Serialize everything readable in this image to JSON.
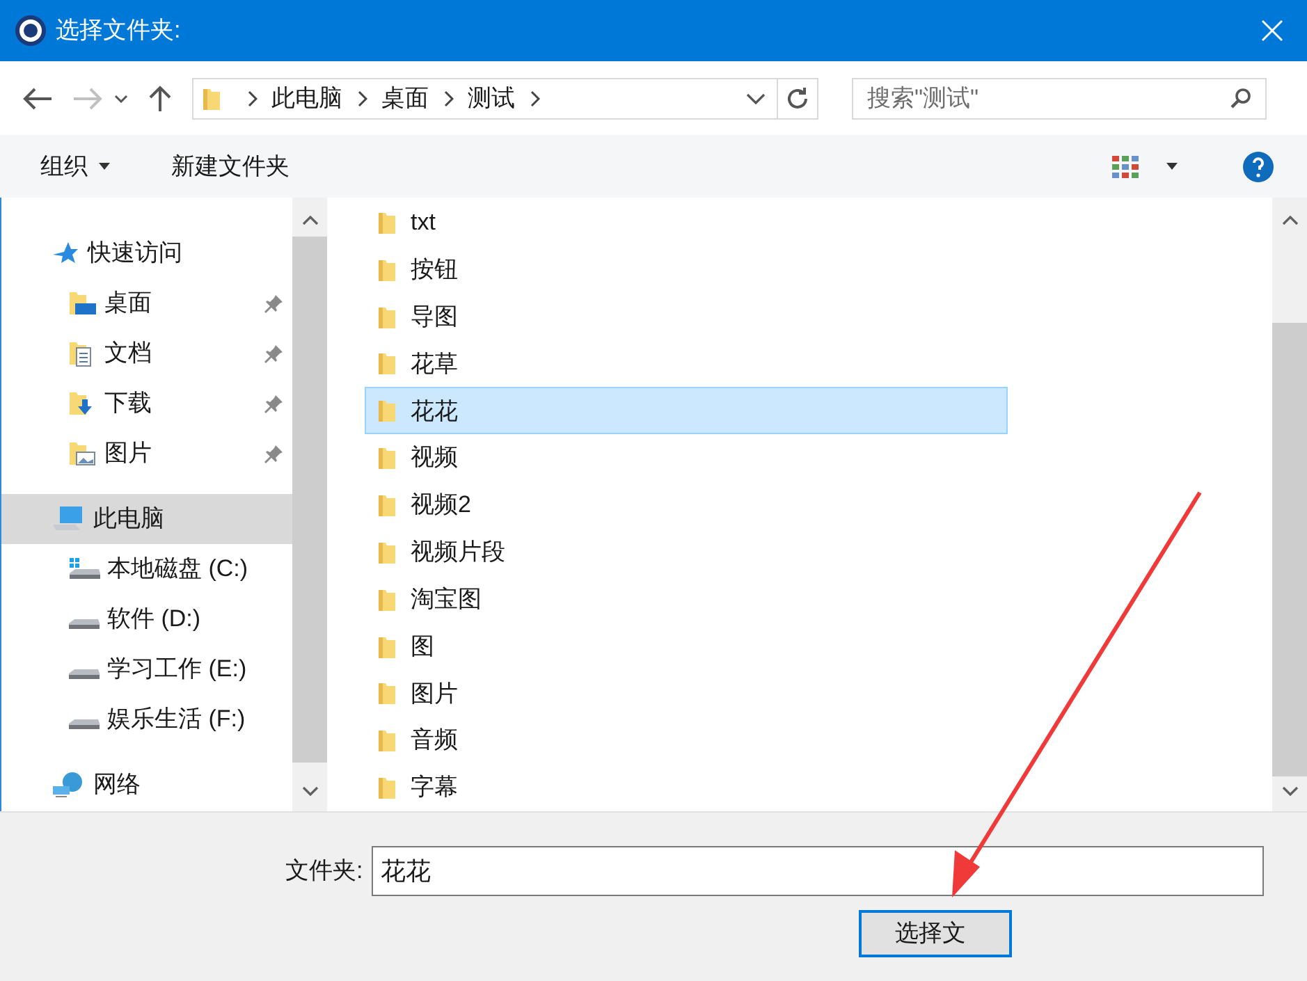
{
  "window": {
    "title": "选择文件夹:"
  },
  "address": {
    "crumbs": [
      "此电脑",
      "桌面",
      "测试"
    ]
  },
  "search": {
    "placeholder": "搜索\"测试\""
  },
  "toolbar": {
    "organize": "组织",
    "new_folder": "新建文件夹"
  },
  "nav": [
    {
      "label": "快速访问",
      "kind": "star",
      "selected": false,
      "children": [
        {
          "label": "桌面",
          "kind": "desktop",
          "pinned": true,
          "selected": false
        },
        {
          "label": "文档",
          "kind": "docs",
          "pinned": true,
          "selected": false
        },
        {
          "label": "下载",
          "kind": "download",
          "pinned": true,
          "selected": false
        },
        {
          "label": "图片",
          "kind": "pictures",
          "pinned": true,
          "selected": false
        }
      ]
    },
    {
      "label": "此电脑",
      "kind": "pc",
      "selected": true,
      "children": [
        {
          "label": "本地磁盘 (C:)",
          "kind": "windisk",
          "pinned": false,
          "selected": false
        },
        {
          "label": "软件 (D:)",
          "kind": "disk",
          "pinned": false,
          "selected": false
        },
        {
          "label": "学习工作 (E:)",
          "kind": "disk",
          "pinned": false,
          "selected": false
        },
        {
          "label": "娱乐生活 (F:)",
          "kind": "disk",
          "pinned": false,
          "selected": false
        }
      ]
    },
    {
      "label": "网络",
      "kind": "network",
      "selected": false
    }
  ],
  "files": [
    {
      "name": "txt",
      "selected": false
    },
    {
      "name": "按钮",
      "selected": false
    },
    {
      "name": "导图",
      "selected": false
    },
    {
      "name": "花草",
      "selected": false
    },
    {
      "name": "花花",
      "selected": true
    },
    {
      "name": "视频",
      "selected": false
    },
    {
      "name": "视频2",
      "selected": false
    },
    {
      "name": "视频片段",
      "selected": false
    },
    {
      "name": "淘宝图",
      "selected": false
    },
    {
      "name": "图",
      "selected": false
    },
    {
      "name": "图片",
      "selected": false
    },
    {
      "name": "音频",
      "selected": false
    },
    {
      "name": "字幕",
      "selected": false
    }
  ],
  "folder_field": {
    "label": "文件夹:",
    "value": "花花"
  },
  "buttons": [
    "选择文"
  ]
}
